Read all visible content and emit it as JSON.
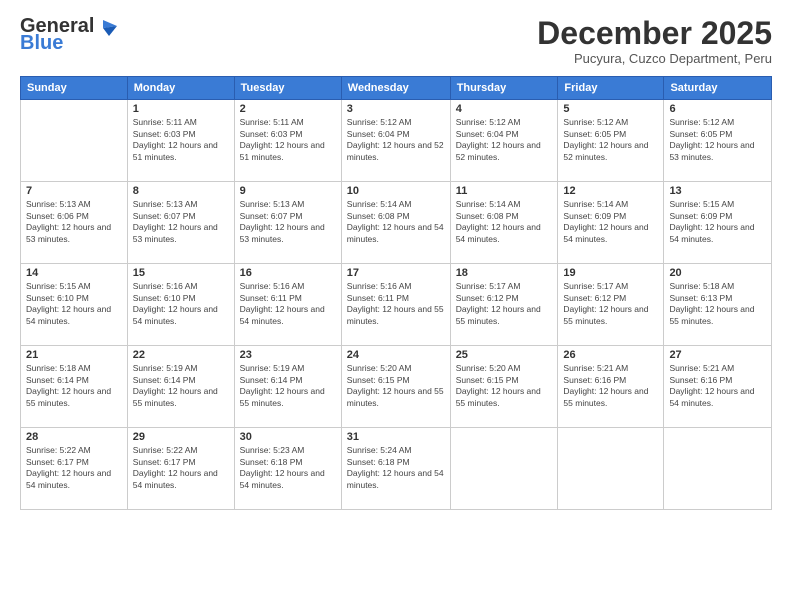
{
  "logo": {
    "general": "General",
    "blue": "Blue"
  },
  "title": "December 2025",
  "location": "Pucyura, Cuzco Department, Peru",
  "weekdays": [
    "Sunday",
    "Monday",
    "Tuesday",
    "Wednesday",
    "Thursday",
    "Friday",
    "Saturday"
  ],
  "weeks": [
    [
      {
        "day": "",
        "sunrise": "",
        "sunset": "",
        "daylight": ""
      },
      {
        "day": "1",
        "sunrise": "Sunrise: 5:11 AM",
        "sunset": "Sunset: 6:03 PM",
        "daylight": "Daylight: 12 hours and 51 minutes."
      },
      {
        "day": "2",
        "sunrise": "Sunrise: 5:11 AM",
        "sunset": "Sunset: 6:03 PM",
        "daylight": "Daylight: 12 hours and 51 minutes."
      },
      {
        "day": "3",
        "sunrise": "Sunrise: 5:12 AM",
        "sunset": "Sunset: 6:04 PM",
        "daylight": "Daylight: 12 hours and 52 minutes."
      },
      {
        "day": "4",
        "sunrise": "Sunrise: 5:12 AM",
        "sunset": "Sunset: 6:04 PM",
        "daylight": "Daylight: 12 hours and 52 minutes."
      },
      {
        "day": "5",
        "sunrise": "Sunrise: 5:12 AM",
        "sunset": "Sunset: 6:05 PM",
        "daylight": "Daylight: 12 hours and 52 minutes."
      },
      {
        "day": "6",
        "sunrise": "Sunrise: 5:12 AM",
        "sunset": "Sunset: 6:05 PM",
        "daylight": "Daylight: 12 hours and 53 minutes."
      }
    ],
    [
      {
        "day": "7",
        "sunrise": "Sunrise: 5:13 AM",
        "sunset": "Sunset: 6:06 PM",
        "daylight": "Daylight: 12 hours and 53 minutes."
      },
      {
        "day": "8",
        "sunrise": "Sunrise: 5:13 AM",
        "sunset": "Sunset: 6:07 PM",
        "daylight": "Daylight: 12 hours and 53 minutes."
      },
      {
        "day": "9",
        "sunrise": "Sunrise: 5:13 AM",
        "sunset": "Sunset: 6:07 PM",
        "daylight": "Daylight: 12 hours and 53 minutes."
      },
      {
        "day": "10",
        "sunrise": "Sunrise: 5:14 AM",
        "sunset": "Sunset: 6:08 PM",
        "daylight": "Daylight: 12 hours and 54 minutes."
      },
      {
        "day": "11",
        "sunrise": "Sunrise: 5:14 AM",
        "sunset": "Sunset: 6:08 PM",
        "daylight": "Daylight: 12 hours and 54 minutes."
      },
      {
        "day": "12",
        "sunrise": "Sunrise: 5:14 AM",
        "sunset": "Sunset: 6:09 PM",
        "daylight": "Daylight: 12 hours and 54 minutes."
      },
      {
        "day": "13",
        "sunrise": "Sunrise: 5:15 AM",
        "sunset": "Sunset: 6:09 PM",
        "daylight": "Daylight: 12 hours and 54 minutes."
      }
    ],
    [
      {
        "day": "14",
        "sunrise": "Sunrise: 5:15 AM",
        "sunset": "Sunset: 6:10 PM",
        "daylight": "Daylight: 12 hours and 54 minutes."
      },
      {
        "day": "15",
        "sunrise": "Sunrise: 5:16 AM",
        "sunset": "Sunset: 6:10 PM",
        "daylight": "Daylight: 12 hours and 54 minutes."
      },
      {
        "day": "16",
        "sunrise": "Sunrise: 5:16 AM",
        "sunset": "Sunset: 6:11 PM",
        "daylight": "Daylight: 12 hours and 54 minutes."
      },
      {
        "day": "17",
        "sunrise": "Sunrise: 5:16 AM",
        "sunset": "Sunset: 6:11 PM",
        "daylight": "Daylight: 12 hours and 55 minutes."
      },
      {
        "day": "18",
        "sunrise": "Sunrise: 5:17 AM",
        "sunset": "Sunset: 6:12 PM",
        "daylight": "Daylight: 12 hours and 55 minutes."
      },
      {
        "day": "19",
        "sunrise": "Sunrise: 5:17 AM",
        "sunset": "Sunset: 6:12 PM",
        "daylight": "Daylight: 12 hours and 55 minutes."
      },
      {
        "day": "20",
        "sunrise": "Sunrise: 5:18 AM",
        "sunset": "Sunset: 6:13 PM",
        "daylight": "Daylight: 12 hours and 55 minutes."
      }
    ],
    [
      {
        "day": "21",
        "sunrise": "Sunrise: 5:18 AM",
        "sunset": "Sunset: 6:14 PM",
        "daylight": "Daylight: 12 hours and 55 minutes."
      },
      {
        "day": "22",
        "sunrise": "Sunrise: 5:19 AM",
        "sunset": "Sunset: 6:14 PM",
        "daylight": "Daylight: 12 hours and 55 minutes."
      },
      {
        "day": "23",
        "sunrise": "Sunrise: 5:19 AM",
        "sunset": "Sunset: 6:14 PM",
        "daylight": "Daylight: 12 hours and 55 minutes."
      },
      {
        "day": "24",
        "sunrise": "Sunrise: 5:20 AM",
        "sunset": "Sunset: 6:15 PM",
        "daylight": "Daylight: 12 hours and 55 minutes."
      },
      {
        "day": "25",
        "sunrise": "Sunrise: 5:20 AM",
        "sunset": "Sunset: 6:15 PM",
        "daylight": "Daylight: 12 hours and 55 minutes."
      },
      {
        "day": "26",
        "sunrise": "Sunrise: 5:21 AM",
        "sunset": "Sunset: 6:16 PM",
        "daylight": "Daylight: 12 hours and 55 minutes."
      },
      {
        "day": "27",
        "sunrise": "Sunrise: 5:21 AM",
        "sunset": "Sunset: 6:16 PM",
        "daylight": "Daylight: 12 hours and 54 minutes."
      }
    ],
    [
      {
        "day": "28",
        "sunrise": "Sunrise: 5:22 AM",
        "sunset": "Sunset: 6:17 PM",
        "daylight": "Daylight: 12 hours and 54 minutes."
      },
      {
        "day": "29",
        "sunrise": "Sunrise: 5:22 AM",
        "sunset": "Sunset: 6:17 PM",
        "daylight": "Daylight: 12 hours and 54 minutes."
      },
      {
        "day": "30",
        "sunrise": "Sunrise: 5:23 AM",
        "sunset": "Sunset: 6:18 PM",
        "daylight": "Daylight: 12 hours and 54 minutes."
      },
      {
        "day": "31",
        "sunrise": "Sunrise: 5:24 AM",
        "sunset": "Sunset: 6:18 PM",
        "daylight": "Daylight: 12 hours and 54 minutes."
      },
      {
        "day": "",
        "sunrise": "",
        "sunset": "",
        "daylight": ""
      },
      {
        "day": "",
        "sunrise": "",
        "sunset": "",
        "daylight": ""
      },
      {
        "day": "",
        "sunrise": "",
        "sunset": "",
        "daylight": ""
      }
    ]
  ]
}
